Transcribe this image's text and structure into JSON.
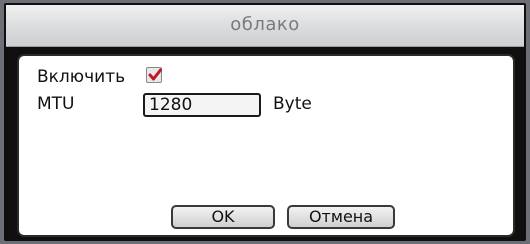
{
  "dialog": {
    "title": "облако",
    "enable_label": "Включить",
    "enable_checked": true,
    "mtu_label": "MTU",
    "mtu_value": "1280",
    "mtu_unit": "Byte",
    "ok_label": "OK",
    "cancel_label": "Отмена"
  },
  "colors": {
    "check_mark": "#c0182a",
    "title_text": "#777b80",
    "frame": "#0f0f10"
  },
  "icons": {
    "enable_checkbox": "check-icon"
  }
}
